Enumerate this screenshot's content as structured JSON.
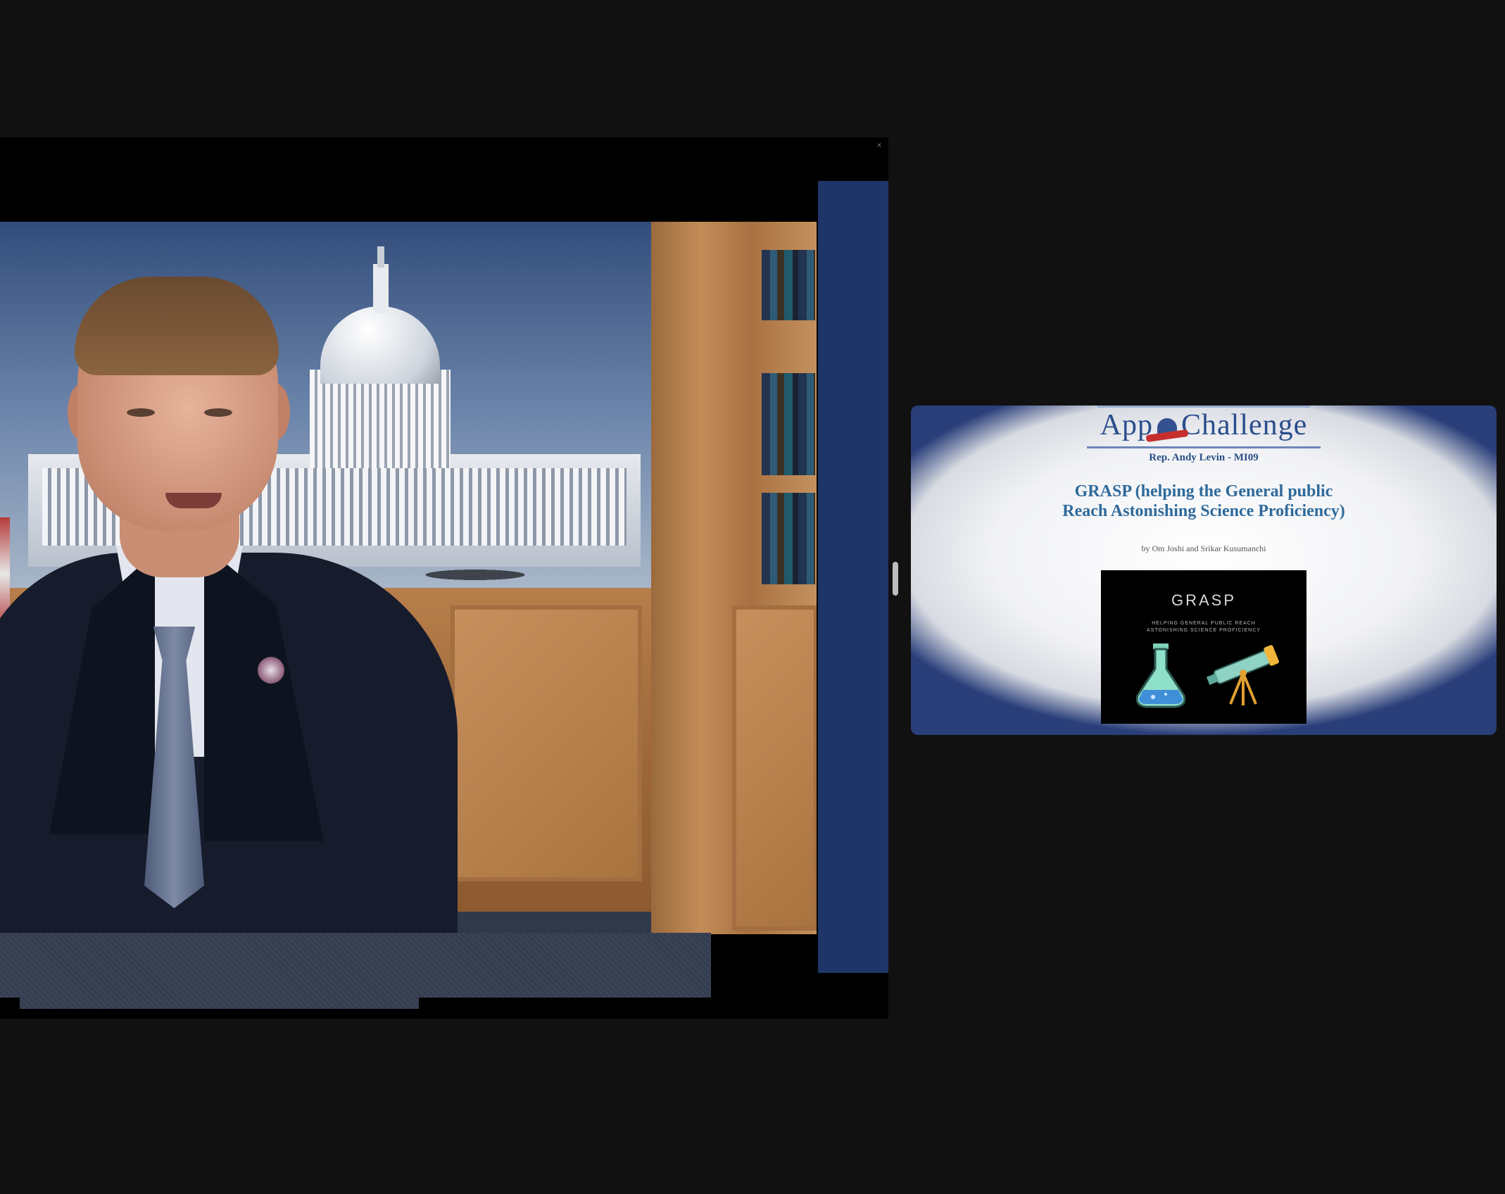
{
  "video": {
    "close_glyph": "×"
  },
  "slide": {
    "logo_text_left": "App",
    "logo_text_right": "Challenge",
    "representative": "Rep. Andy Levin - MI09",
    "title": "GRASP (helping the General public Reach Astonishing Science Proficiency)",
    "byline": "by Om Joshi and Srikar Kusumanchi",
    "app_logo": {
      "name": "GRASP",
      "tagline_line1": "HELPING GENERAL PUBLIC REACH",
      "tagline_line2": "ASTONISHING SCIENCE PROFICIENCY",
      "icons": [
        "flask-icon",
        "telescope-icon"
      ]
    }
  },
  "colors": {
    "background": "#111111",
    "accent_blue": "#1f3567",
    "slide_title": "#2e6a9b"
  }
}
